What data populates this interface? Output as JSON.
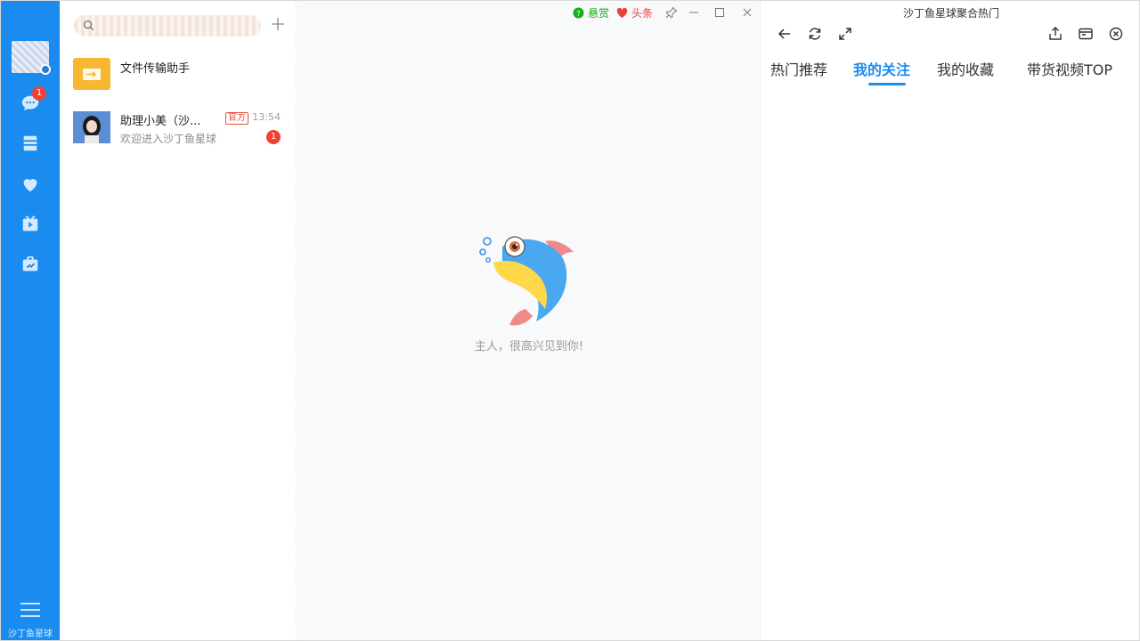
{
  "rail": {
    "chat_badge": "1",
    "brand": "沙丁鱼星球"
  },
  "list": {
    "conversations": [
      {
        "name": "文件传输助手",
        "subtitle": "",
        "time": "",
        "tag": "",
        "unread": ""
      },
      {
        "name": "助理小美（沙...",
        "subtitle": "欢迎进入沙丁鱼星球",
        "time": "13:54",
        "tag": "官方",
        "unread": "1"
      }
    ]
  },
  "center": {
    "bounty_label": "悬赏",
    "headlines_label": "头条",
    "welcome": "主人，很高兴见到你!"
  },
  "right": {
    "title": "沙丁鱼星球聚合热门",
    "tabs": [
      {
        "label": "热门推荐",
        "active": false
      },
      {
        "label": "我的关注",
        "active": true
      },
      {
        "label": "我的收藏",
        "active": false
      },
      {
        "label": "带货视频TOP",
        "active": false
      }
    ]
  },
  "colors": {
    "accent": "#1a8cf0",
    "badge": "#f04134",
    "bounty": "#1aad19",
    "headlines": "#e64340"
  }
}
